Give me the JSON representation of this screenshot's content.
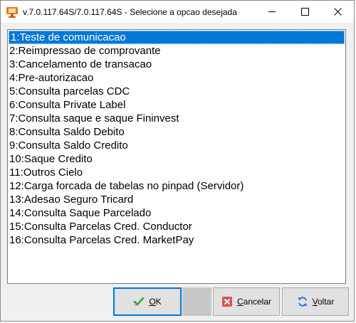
{
  "window": {
    "title": "v.7.0.117.64S/7.0.117.64S - Selecione a opcao desejada"
  },
  "options": [
    "1:Teste de comunicacao",
    "2:Reimpressao de comprovante",
    "3:Cancelamento de transacao",
    "4:Pre-autorizacao",
    "5:Consulta parcelas CDC",
    "6:Consulta Private Label",
    "7:Consulta saque e saque Fininvest",
    "8:Consulta Saldo Debito",
    "9:Consulta Saldo Credito",
    "10:Saque Credito",
    "11:Outros Cielo",
    "12:Carga forcada de tabelas no pinpad (Servidor)",
    "13:Adesao Seguro Tricard",
    "14:Consulta Saque Parcelado",
    "15:Consulta Parcelas Cred. Conductor",
    "16:Consulta Parcelas Cred. MarketPay"
  ],
  "selected_index": 0,
  "buttons": {
    "ok": {
      "mnemonic": "O",
      "rest": "K",
      "icon": "check-icon"
    },
    "cancel": {
      "mnemonic": "C",
      "rest": "ancelar",
      "icon": "cancel-icon"
    },
    "back": {
      "mnemonic": "V",
      "rest": "oltar",
      "icon": "refresh-icon"
    }
  },
  "colors": {
    "selection": "#0078d7",
    "ok_border": "#0078d7",
    "app_icon": "#e07a1f"
  }
}
